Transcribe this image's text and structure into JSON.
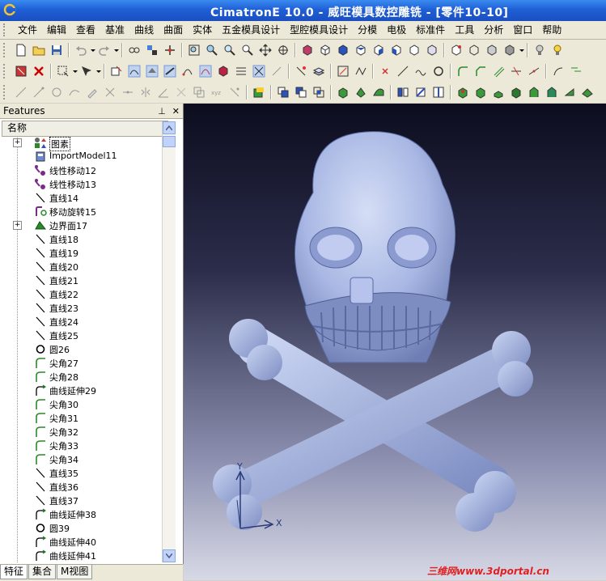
{
  "window": {
    "title": "CimatronE 10.0 - 威旺模具数控雕铣 - [零件10-10]"
  },
  "menu": [
    "文件",
    "编辑",
    "查看",
    "基准",
    "曲线",
    "曲面",
    "实体",
    "五金模具设计",
    "型腔模具设计",
    "分模",
    "电极",
    "标准件",
    "工具",
    "分析",
    "窗口",
    "帮助"
  ],
  "panel": {
    "title": "Features",
    "pin": "⊥",
    "close": "✕",
    "column_header": "名称"
  },
  "tree": [
    {
      "label": "图素",
      "icon": "layers-icon",
      "expand": "+",
      "selected": true
    },
    {
      "label": "ImportModel11",
      "icon": "import-model-icon"
    },
    {
      "label": "线性移动12",
      "icon": "linear-move-icon"
    },
    {
      "label": "线性移动13",
      "icon": "linear-move-icon"
    },
    {
      "label": "直线14",
      "icon": "line-icon"
    },
    {
      "label": "移动旋转15",
      "icon": "move-rotate-icon"
    },
    {
      "label": "边界面17",
      "icon": "boundary-surface-icon",
      "expand": "+"
    },
    {
      "label": "直线18",
      "icon": "line-icon"
    },
    {
      "label": "直线19",
      "icon": "line-icon"
    },
    {
      "label": "直线20",
      "icon": "line-icon"
    },
    {
      "label": "直线21",
      "icon": "line-icon"
    },
    {
      "label": "直线22",
      "icon": "line-icon"
    },
    {
      "label": "直线23",
      "icon": "line-icon"
    },
    {
      "label": "直线24",
      "icon": "line-icon"
    },
    {
      "label": "直线25",
      "icon": "line-icon"
    },
    {
      "label": "圆26",
      "icon": "circle-icon"
    },
    {
      "label": "尖角27",
      "icon": "corner-icon"
    },
    {
      "label": "尖角28",
      "icon": "corner-icon"
    },
    {
      "label": "曲线延伸29",
      "icon": "curve-extend-icon"
    },
    {
      "label": "尖角30",
      "icon": "corner-icon"
    },
    {
      "label": "尖角31",
      "icon": "corner-icon"
    },
    {
      "label": "尖角32",
      "icon": "corner-icon"
    },
    {
      "label": "尖角33",
      "icon": "corner-icon"
    },
    {
      "label": "尖角34",
      "icon": "corner-icon"
    },
    {
      "label": "直线35",
      "icon": "line-icon"
    },
    {
      "label": "直线36",
      "icon": "line-icon"
    },
    {
      "label": "直线37",
      "icon": "line-icon"
    },
    {
      "label": "曲线延伸38",
      "icon": "curve-extend-icon"
    },
    {
      "label": "圆39",
      "icon": "circle-icon"
    },
    {
      "label": "曲线延伸40",
      "icon": "curve-extend-icon"
    },
    {
      "label": "曲线延伸41",
      "icon": "curve-extend-icon"
    }
  ],
  "tabs": [
    "特征",
    "集合",
    "M视图"
  ],
  "viewport": {
    "axis_x": "X",
    "axis_y": "Y"
  },
  "watermark": "三维网www.3dportal.cn",
  "colors": {
    "title_bar": "#1f5fd6",
    "viewport_top": "#0d0d1f",
    "viewport_bottom": "#d8d9e6",
    "model": "#aebde8",
    "watermark": "#e02020"
  }
}
